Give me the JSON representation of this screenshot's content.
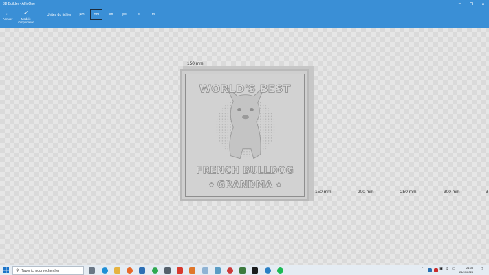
{
  "window": {
    "title": "3D Builder - AffinOne"
  },
  "toolbar": {
    "cancel_label": "Annuler",
    "import_model_label_line1": "Modèle",
    "import_model_label_line2": "d'importation",
    "file_unit_label": "Unités du fichier",
    "units": [
      "µm",
      "mm",
      "cm",
      "po",
      "pi",
      "m"
    ],
    "selected_unit": "mm"
  },
  "viewport": {
    "dimension_top": "150 mm",
    "ruler_labels": [
      "150 mm",
      "200 mm",
      "250 mm",
      "300 mm",
      "3"
    ]
  },
  "model": {
    "text_top": "WORLD'S BEST",
    "text_middle": "FRENCH BULLDOG",
    "text_bottom": "GRANDMA"
  },
  "taskbar": {
    "search_placeholder": "Taper ici pour rechercher",
    "clock_time": "21:08",
    "clock_date": "24/07/2024"
  },
  "colors": {
    "accent": "#3a8fd6",
    "taskbar": "#e5ecf3"
  }
}
